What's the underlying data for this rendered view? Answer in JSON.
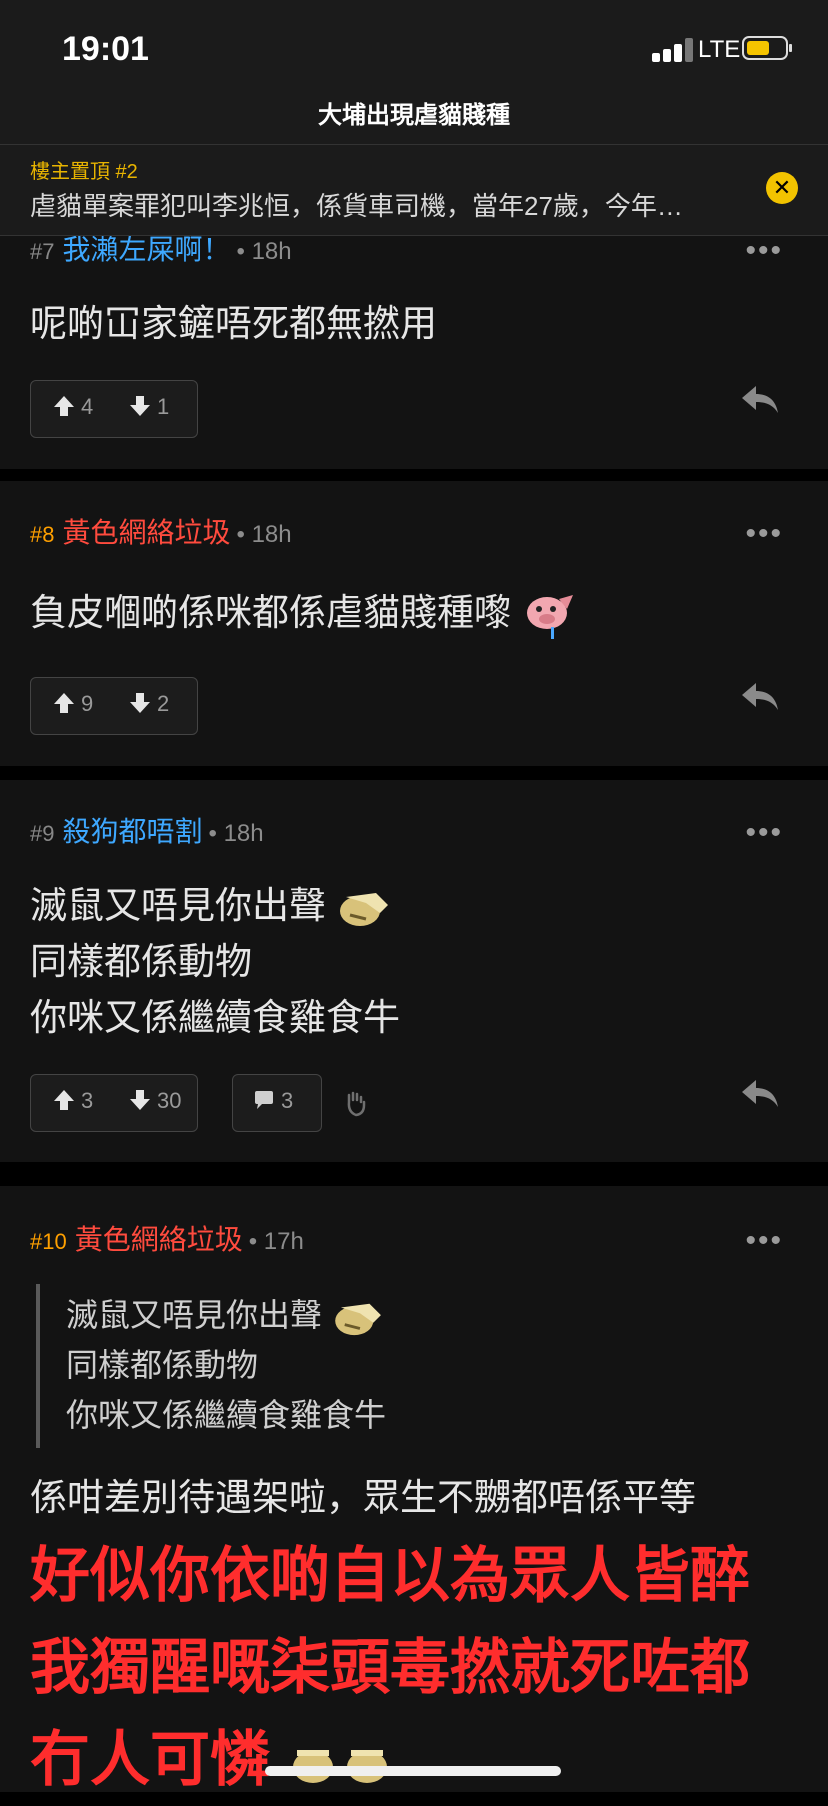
{
  "status_bar": {
    "time": "19:01",
    "network": "LTE"
  },
  "thread_title": "大埔出現虐貓賤種",
  "pinned": {
    "label": "樓主置頂 #2",
    "text": "虐貓單案罪犯叫李兆恒，係貨車司機，當年27歲，今年…"
  },
  "colors": {
    "accent_yellow": "#f2c300",
    "user_blue": "#3ea8ff",
    "user_red": "#ff4b3e",
    "highlight_red": "#ff2d2d",
    "num_orange": "#ffa000"
  },
  "posts": [
    {
      "num": "#7",
      "user": "我瀨左屎啊！",
      "time": "• 18h",
      "lines": [
        "呢啲冚家鏟唔死都無撚用"
      ],
      "up": "4",
      "down": "1"
    },
    {
      "num": "#8",
      "user": "黃色網絡垃圾",
      "time": "• 18h",
      "lines": [
        "負皮嗰啲係咪都係虐貓賤種嚟"
      ],
      "up": "9",
      "down": "2"
    },
    {
      "num": "#9",
      "user": "殺狗都唔割",
      "time": "• 18h",
      "lines": [
        "滅鼠又唔見你出聲",
        "同樣都係動物",
        "你咪又係繼續食雞食牛"
      ],
      "up": "3",
      "down": "30",
      "comments": "3"
    },
    {
      "num": "#10",
      "user": "黃色網絡垃圾",
      "time": "• 17h",
      "quote": [
        "滅鼠又唔見你出聲",
        "同樣都係動物",
        "你咪又係繼續食雞食牛"
      ],
      "body": "係咁差別待遇架啦，眾生不嬲都唔係平等",
      "big": [
        "好似你依啲自以為眾人皆醉",
        "我獨醒嘅柒頭毒撚就死咗都",
        "冇人可憐"
      ]
    }
  ]
}
